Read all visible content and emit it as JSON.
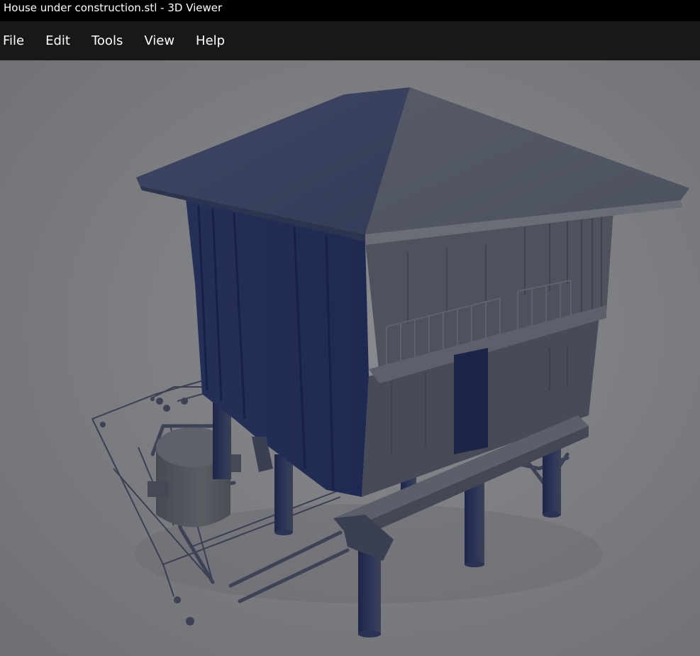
{
  "window": {
    "title": "House under construction.stl - 3D Viewer"
  },
  "menu": {
    "items": [
      {
        "label": "File"
      },
      {
        "label": "Edit"
      },
      {
        "label": "Tools"
      },
      {
        "label": "View"
      },
      {
        "label": "Help"
      }
    ]
  },
  "viewport": {
    "model_name": "house-under-construction",
    "background_color": "#7b7c80",
    "model_color": "#2a3358"
  }
}
